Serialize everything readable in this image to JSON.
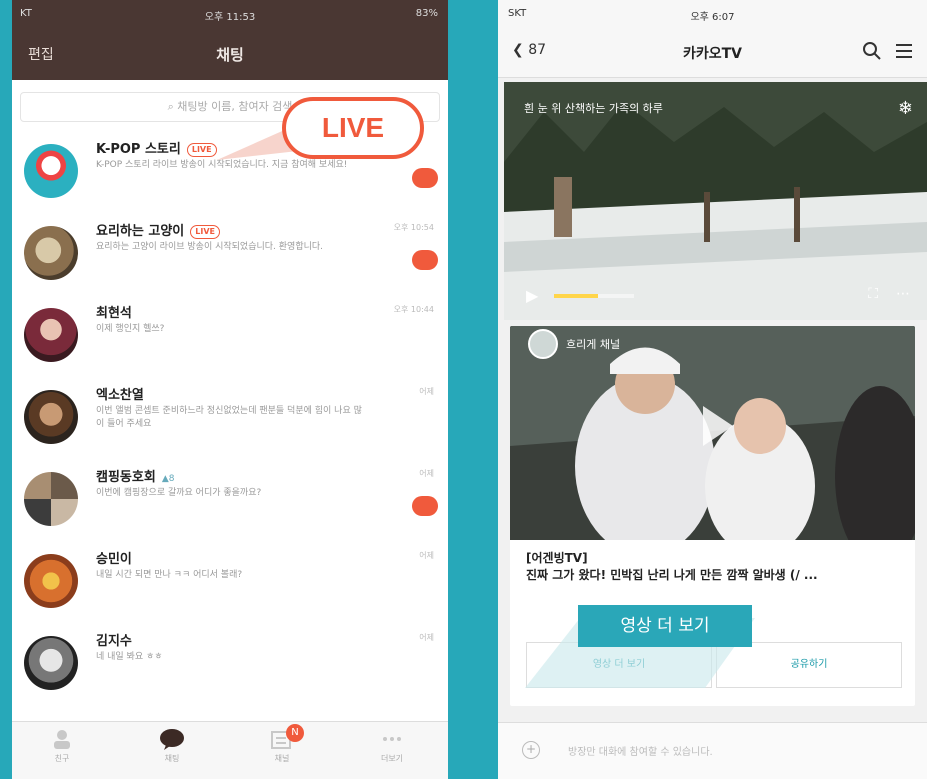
{
  "colors": {
    "background": "#27a8b9",
    "accent_red": "#f05a3c",
    "header_brown": "#4a3733",
    "teal": "#2aa7b8"
  },
  "left": {
    "status": {
      "carrier": "KT",
      "time": "오후 11:53",
      "battery": "83%"
    },
    "header": {
      "edit": "편집",
      "title": "채팅"
    },
    "search_placeholder": "채팅방 이름, 참여자 검색",
    "live_callout": "LIVE",
    "chats": [
      {
        "name": "K-POP 스토리",
        "live": "LIVE",
        "message": "K-POP 스토리 라이브 방송이 시작되었습니다. 지금 참여해 보세요!",
        "time": "",
        "unread": true,
        "icon": "santa-avatar"
      },
      {
        "name": "요리하는 고양이",
        "live": "LIVE",
        "message": "요리하는 고양이 라이브 방송이 시작되었습니다. 환영합니다.",
        "time": "오후 10:54",
        "unread": true,
        "icon": "cat-avatar"
      },
      {
        "name": "최현석",
        "live": "",
        "message": "이제 행인지 헬쓰?",
        "time": "오후 10:44",
        "unread": false,
        "icon": "person-avatar"
      },
      {
        "name": "엑소찬열",
        "live": "",
        "message": "이번 앨범 콘셉트 준비하느라 정신없었는데 팬분들 덕분에 힘이 나요 많이 들어 주세요",
        "time": "어제",
        "unread": false,
        "icon": "person-avatar"
      },
      {
        "name": "캠핑동호회",
        "live": "",
        "count": "8",
        "message": "이번에 캠핑장으로 갈까요 어디가 좋을까요?",
        "time": "어제",
        "unread": true,
        "icon": "group-avatar"
      },
      {
        "name": "승민이",
        "live": "",
        "message": "내일 시간 되면 만나 ㅋㅋ 어디서 볼래?",
        "time": "어제",
        "unread": false,
        "icon": "food-avatar"
      },
      {
        "name": "김지수",
        "live": "",
        "message": "네 내일 봐요 ㅎㅎ",
        "time": "어제",
        "unread": false,
        "icon": "person-avatar"
      }
    ],
    "tabs": [
      {
        "label": "친구",
        "icon": "person-icon",
        "active": false
      },
      {
        "label": "채팅",
        "icon": "chat-bubble-icon",
        "active": true
      },
      {
        "label": "채널",
        "icon": "channel-icon",
        "active": false,
        "badge": "N"
      },
      {
        "label": "더보기",
        "icon": "more-icon",
        "active": false
      }
    ]
  },
  "right": {
    "status": {
      "carrier": "SKT",
      "time": "오후 6:07"
    },
    "nav": {
      "back": "87",
      "title": "카카오TV"
    },
    "video1": {
      "title": "흰 눈 위 산책하는 가족의 하루",
      "progress": 0.55
    },
    "card": {
      "channel": "흐리게 채널",
      "title_prefix": "[어겐빙TV]",
      "title": "진짜 그가 왔다! 민박집 난리 나게 만든 깜짝 알바생 (/ ...",
      "more_button": "영상 더 보기",
      "share_button": "공유하기"
    },
    "more_callout": "영상 더 보기",
    "input_placeholder": "방장만 대화에 참여할 수 있습니다."
  }
}
